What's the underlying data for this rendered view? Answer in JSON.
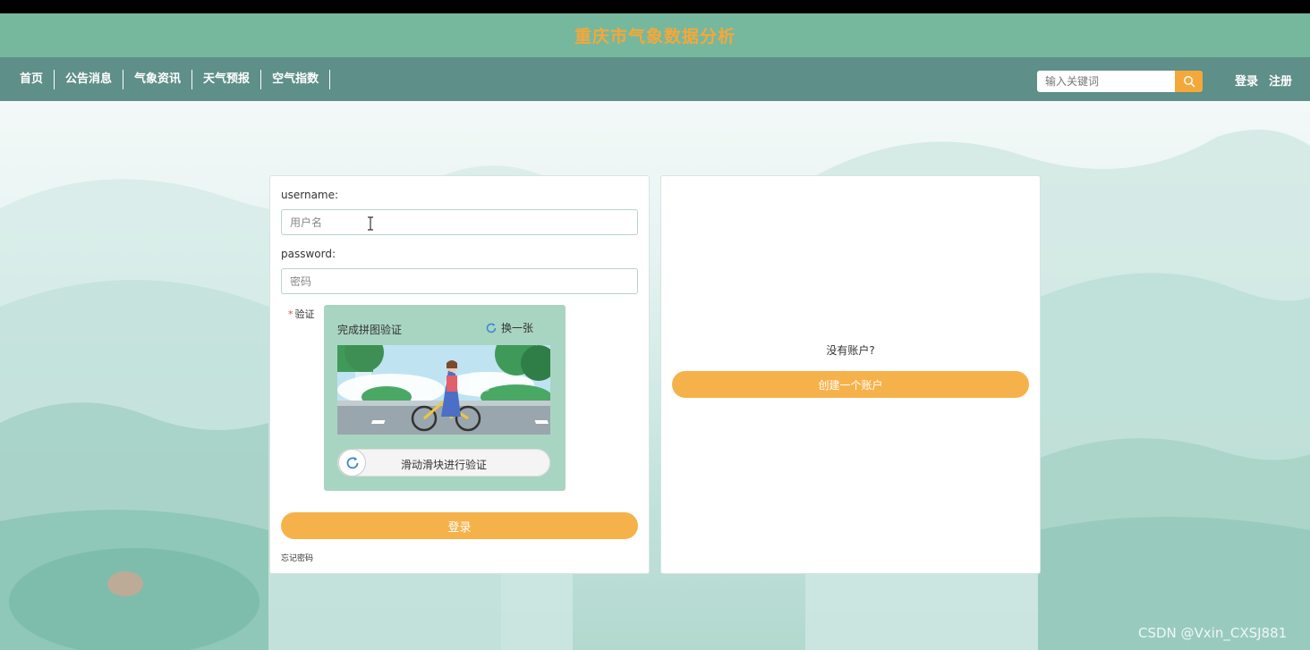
{
  "header": {
    "title": "重庆市气象数据分析"
  },
  "nav": {
    "items": [
      {
        "label": "首页"
      },
      {
        "label": "公告消息"
      },
      {
        "label": "气象资讯"
      },
      {
        "label": "天气预报"
      },
      {
        "label": "空气指数"
      }
    ],
    "search_placeholder": "输入关键词",
    "search_icon": "search-icon",
    "login": "登录",
    "register": "注册"
  },
  "login_form": {
    "username_label": "username:",
    "username_placeholder": "用户名",
    "password_label": "password:",
    "password_placeholder": "密码",
    "verify_required_mark": "*",
    "verify_label": "验证",
    "captcha_title": "完成拼图验证",
    "captcha_refresh": "换一张",
    "slider_text": "滑动滑块进行验证",
    "submit": "登录",
    "forgot": "忘记密码"
  },
  "register_panel": {
    "prompt": "没有账户?",
    "create_button": "创建一个账户"
  },
  "watermark": "CSDN @Vxin_CXSJ881",
  "colors": {
    "header_bg": "#76b89d",
    "nav_bg": "#5e8f88",
    "accent_orange": "#f6b24a",
    "title_orange": "#f4a83a",
    "captcha_bg": "#a8d5c1"
  }
}
